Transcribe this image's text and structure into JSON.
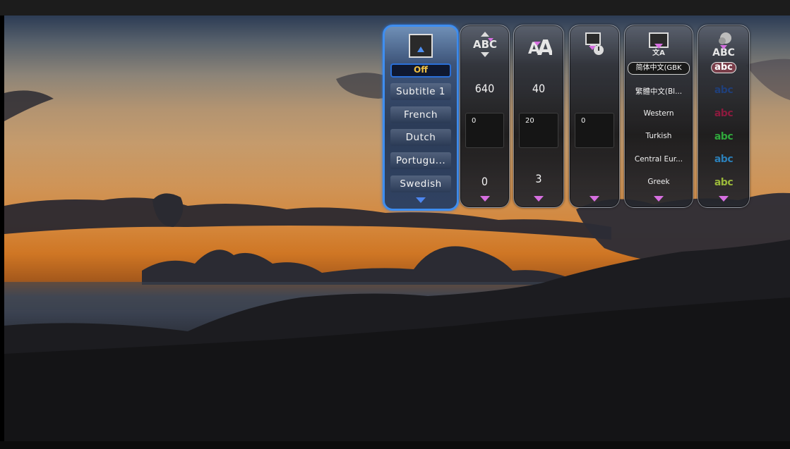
{
  "subtitle_track": {
    "icon": "subtitle-screen-icon",
    "selected": "Off",
    "items": [
      "Subtitle 1",
      "French",
      "Dutch",
      "Portugu...",
      "Swedish"
    ]
  },
  "position": {
    "icon": "text-position-icon",
    "top_value": "640",
    "field_value": "0",
    "bottom_value": "0"
  },
  "font_size": {
    "icon": "font-size-icon",
    "top_value": "40",
    "field_value": "20",
    "bottom_value": "3"
  },
  "sync": {
    "icon": "subtitle-sync-icon",
    "field_value": "0"
  },
  "encoding": {
    "icon": "text-encoding-icon",
    "selected": "简体中文(GBK",
    "items": [
      "繁體中文(Bl...",
      "Western",
      "Turkish",
      "Central Eur...",
      "Greek"
    ]
  },
  "color": {
    "icon": "text-color-icon",
    "selected_label": "abc",
    "items": [
      {
        "label": "abc",
        "color": "#1f3f7a"
      },
      {
        "label": "abc",
        "color": "#8c1a3e"
      },
      {
        "label": "abc",
        "color": "#2fa83c"
      },
      {
        "label": "abc",
        "color": "#2b7fb8"
      },
      {
        "label": "abc",
        "color": "#9ab83a"
      }
    ]
  },
  "colors": {
    "active_border": "#3f8ef0",
    "arrow": "#d66fe0",
    "selected_text": "#f0c040"
  }
}
